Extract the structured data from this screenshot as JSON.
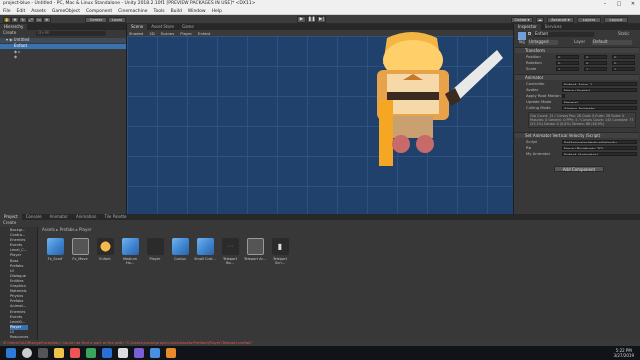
{
  "window": {
    "title": "project-blue - Untitled - PC, Mac & Linux Standalone - Unity 2018.2.10f1 [PREVIEW PACKAGES IN USE]* <DX11>"
  },
  "menu": [
    "File",
    "Edit",
    "Assets",
    "GameObject",
    "Component",
    "Cinemachine",
    "Tools",
    "Build",
    "Window",
    "Help"
  ],
  "toolbar": {
    "pivot": "Center",
    "space": "Local",
    "collab": "Collab ▾",
    "account": "Account ▾",
    "layers": "Layers",
    "layout": "Layout"
  },
  "hierarchy": {
    "tab": "Hierarchy",
    "create": "Create",
    "search_placeholder": "Q+All",
    "scene_name": "Untitled",
    "items": [
      "Enfant"
    ]
  },
  "scene_view": {
    "tabs": [
      "Scene",
      "Asset Store",
      "Game"
    ],
    "shading": "Shaded",
    "mode": "2D",
    "bar_items": [
      "Scenes",
      "Player",
      "Enfant"
    ]
  },
  "inspector": {
    "tabs": [
      "Inspector",
      "Services"
    ],
    "object_name": "Enfant",
    "static": "Static",
    "tag_label": "Tag",
    "tag": "Untagged",
    "layer_label": "Layer",
    "layer": "Default",
    "transform": {
      "title": "Transform",
      "position": "Position",
      "rotation": "Rotation",
      "scale": "Scale",
      "x": "X",
      "y": "Y",
      "z": "Z",
      "pos": [
        "0",
        "0",
        "0"
      ],
      "rot": [
        "0",
        "0",
        "0"
      ],
      "scl": [
        "1",
        "1",
        "1"
      ]
    },
    "animator": {
      "title": "Animator",
      "controller_label": "Controller",
      "controller": "Enfant_Anim_1",
      "avatar_label": "Avatar",
      "avatar": "None (Avatar)",
      "root_motion_label": "Apply Root Motion",
      "update_label": "Update Mode",
      "update": "Normal",
      "culling_label": "Culling Mode",
      "culling": "Always Animate",
      "info": "Clip Count: 12 / Curves Pos: 28 Quat: 0 Euler: 28 Scale: 0 Muscles: 0 Generic: 0 PPtr: 5 / Curves Count: 145 Constant: 77 (53.1%) Dense: 0 (0.0%) Stream: 68 (46.9%)"
    },
    "script": {
      "title": "Set Animator Vertical Velocity (Script)",
      "script_label": "Script",
      "script": "SetAnimatorVerticalVelocity",
      "rb_label": "Rb",
      "rb": "None (Rigidbody 2D)",
      "animator_label": "My Animator",
      "animator": "Enfant (Animator)"
    },
    "add_component": "Add Component"
  },
  "project": {
    "tabs": [
      "Project",
      "Console",
      "Animator",
      "Animation",
      "Tile Palette"
    ],
    "create": "Create",
    "breadcrumb": [
      "Assets",
      "Prefabs",
      "Player"
    ],
    "tree": [
      "Backgr...",
      "Contro...",
      "Enemies",
      "Events",
      "Level_C...",
      "Player",
      "Boss",
      "Prefabs",
      "UI",
      "Dialogue",
      "Entities",
      "Graphics",
      "Materials",
      "Physics",
      "Prefabs",
      "Animat...",
      "Enemies",
      "Events",
      "Level0...",
      "Player",
      "UI",
      "Resources",
      "Scenes"
    ],
    "assets": [
      "Fx_Scarf",
      "Fx_Move",
      "Enfant",
      "Medium Ho...",
      "Player",
      "Cactus",
      "Small Crat...",
      "Teleport Bo...",
      "Teleport Ar...",
      "Teleport Scri..."
    ]
  },
  "status": {
    "error": "IndexOutOfRangeException: Could not find a part of the path \"C:\\Users\\Lucas\\project-blue\\Assets\\Prefabs\\Player\\Teleport.prefab\""
  },
  "taskbar": {
    "time": "5:22 PM",
    "date": "3/27/2019"
  },
  "colors": {
    "scene_bg": "#234873",
    "error": "#e05a4a",
    "accent": "#3f84d0"
  }
}
